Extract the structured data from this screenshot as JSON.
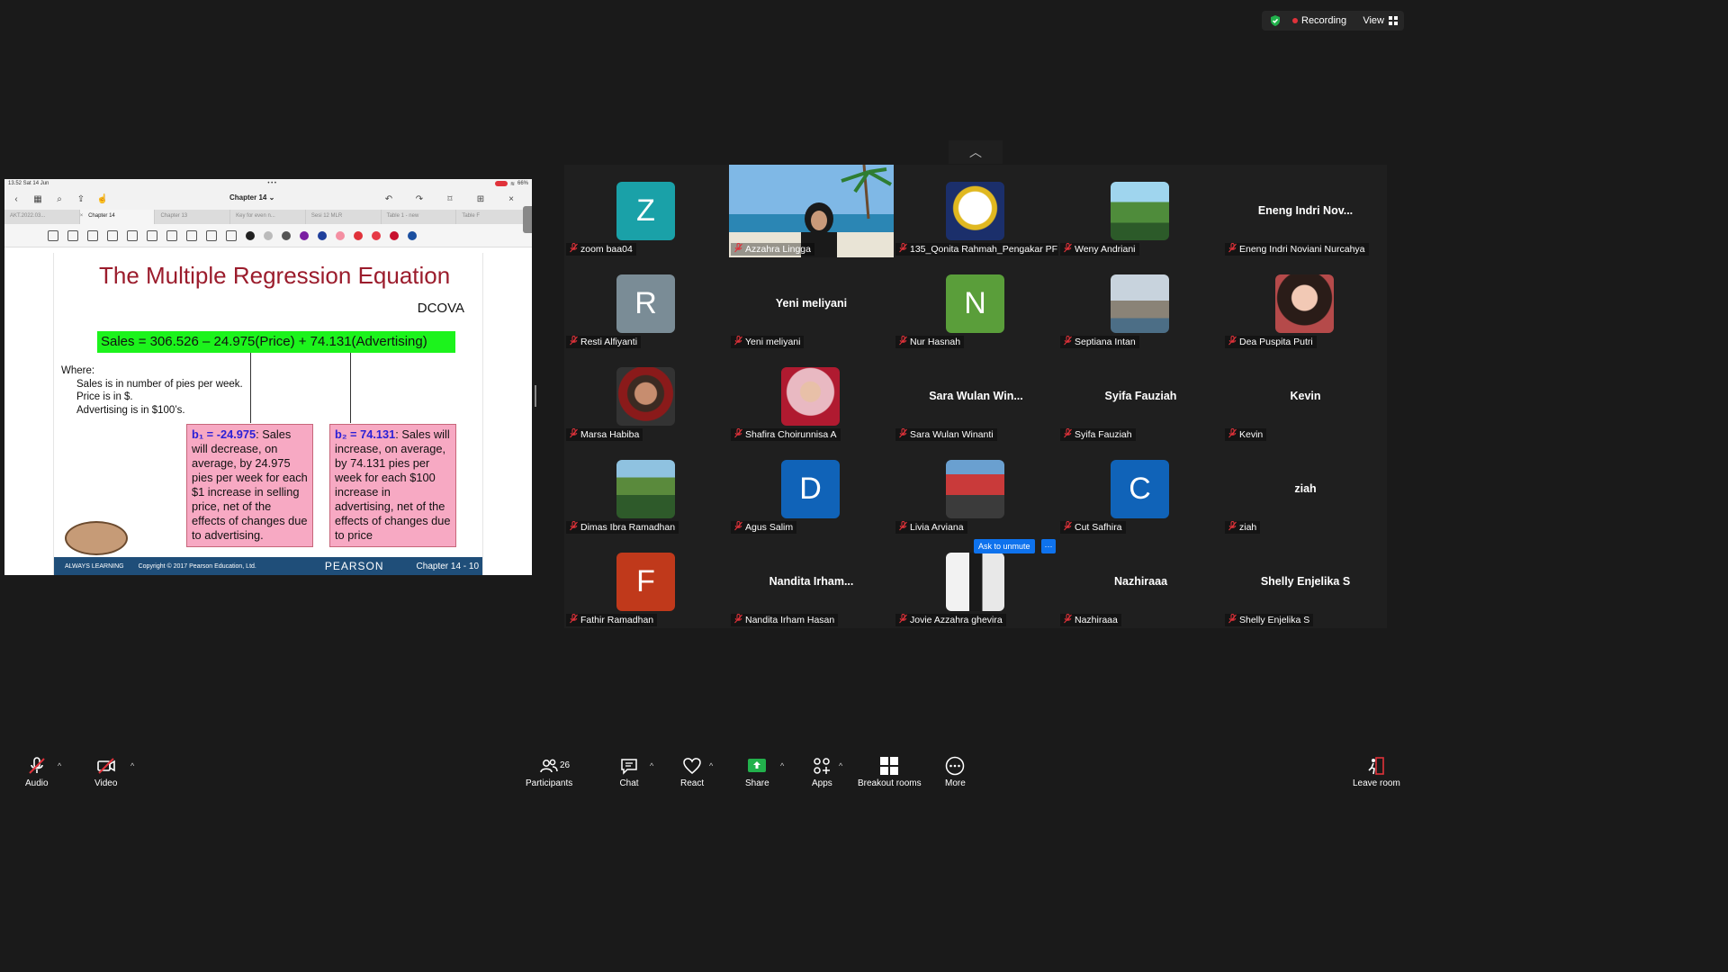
{
  "status": {
    "recording_label": "Recording",
    "view_label": "View"
  },
  "ipad": {
    "time": "13.52  Sat 14 Jun",
    "battery": "66%",
    "doc_title": "Chapter 14 ⌄",
    "tabs": [
      "AKT.2022.03...",
      "Chapter 14",
      "Chapter 13",
      "Key for even n...",
      "Sesi 12 MLR",
      "Table 1 - new",
      "Table F"
    ],
    "tool_colors": [
      "#222222",
      "#bbbbbb",
      "#555555",
      "#7a1fa2",
      "#1f3f9b",
      "#f48fa2",
      "#e0323a",
      "#e63946",
      "#c8102e",
      "#1b4fa0"
    ]
  },
  "slide": {
    "title": "The Multiple Regression Equation",
    "dcova": "DCOVA",
    "equation": "Sales = 306.526 – 24.975(Price) + 74.131(Advertising)",
    "where": "Where:",
    "where_lines": [
      "Sales is in number of pies per week.",
      "Price is in $.",
      "Advertising is in $100’s."
    ],
    "box1_coef": "b₁ = -24.975",
    "box1_text": ": Sales will decrease, on average, by 24.975 pies per week for each $1 increase in selling price, net of the effects of changes due to advertising.",
    "box2_coef": "b₂ = 74.131",
    "box2_text": ": Sales will increase, on average, by 74.131 pies per week for each $100 increase in advertising, net of the effects of changes due to price",
    "footer_left": "ALWAYS LEARNING",
    "footer_copy": "Copyright © 2017 Pearson Education, Ltd.",
    "footer_brand": "PEARSON",
    "footer_chapter": "Chapter 14 - 10"
  },
  "participants": [
    {
      "label": "zoom baa04",
      "kind": "avatar",
      "initial": "Z",
      "color": "#1aa1a8"
    },
    {
      "label": "Azzahra Lingga",
      "kind": "video"
    },
    {
      "label": "135_Qonita Rahmah_Pengakar PF 1",
      "kind": "photo",
      "photo": "logo"
    },
    {
      "label": "Weny Andriani",
      "kind": "photo",
      "photo": "lake"
    },
    {
      "label": "Eneng Indri Noviani Nurcahya",
      "kind": "name",
      "big": "Eneng  Indri  Nov..."
    },
    {
      "label": "Resti Alfiyanti",
      "kind": "avatar",
      "initial": "R",
      "color": "#7a8c96"
    },
    {
      "label": "Yeni meliyani",
      "kind": "name",
      "big": "Yeni meliyani"
    },
    {
      "label": "Nur Hasnah",
      "kind": "avatar",
      "initial": "N",
      "color": "#5a9e3a"
    },
    {
      "label": "Septiana Intan",
      "kind": "photo",
      "photo": "castle"
    },
    {
      "label": "Dea Puspita Putri",
      "kind": "photo",
      "photo": "girl"
    },
    {
      "label": "Marsa Habiba",
      "kind": "photo",
      "photo": "hero"
    },
    {
      "label": "Shafira Choirunnisa A",
      "kind": "photo",
      "photo": "hijab"
    },
    {
      "label": "Sara Wulan Winanti",
      "kind": "name",
      "big": "Sara  Wulan  Win..."
    },
    {
      "label": "Syifa Fauziah",
      "kind": "name",
      "big": "Syifa Fauziah"
    },
    {
      "label": "Kevin",
      "kind": "name",
      "big": "Kevin"
    },
    {
      "label": "Dimas Ibra Ramadhan",
      "kind": "photo",
      "photo": "forest"
    },
    {
      "label": "Agus Salim",
      "kind": "avatar",
      "initial": "D",
      "color": "#1063b8"
    },
    {
      "label": "Livia Arviana",
      "kind": "photo",
      "photo": "stage"
    },
    {
      "label": "Cut Safhira",
      "kind": "avatar",
      "initial": "C",
      "color": "#1063b8"
    },
    {
      "label": "ziah",
      "kind": "name",
      "big": "ziah"
    },
    {
      "label": "Fathir Ramadhan",
      "kind": "avatar",
      "initial": "F",
      "color": "#c0391b"
    },
    {
      "label": "Nandita Irham Hasan",
      "kind": "name",
      "big": "Nandita  Irham..."
    },
    {
      "label": "Jovie Azzahra ghevira",
      "kind": "photo",
      "photo": "silhouette"
    },
    {
      "label": "Nazhiraaa",
      "kind": "name",
      "big": "Nazhiraaa"
    },
    {
      "label": "Shelly Enjelika S",
      "kind": "name",
      "big": "Shelly Enjelika S"
    }
  ],
  "ask_to_unmute": "Ask to unmute",
  "more_dots": "···",
  "toolbar": {
    "audio": "Audio",
    "video": "Video",
    "participants": "Participants",
    "participants_count": "26",
    "chat": "Chat",
    "react": "React",
    "share": "Share",
    "apps": "Apps",
    "breakout": "Breakout rooms",
    "more": "More",
    "leave": "Leave room"
  }
}
